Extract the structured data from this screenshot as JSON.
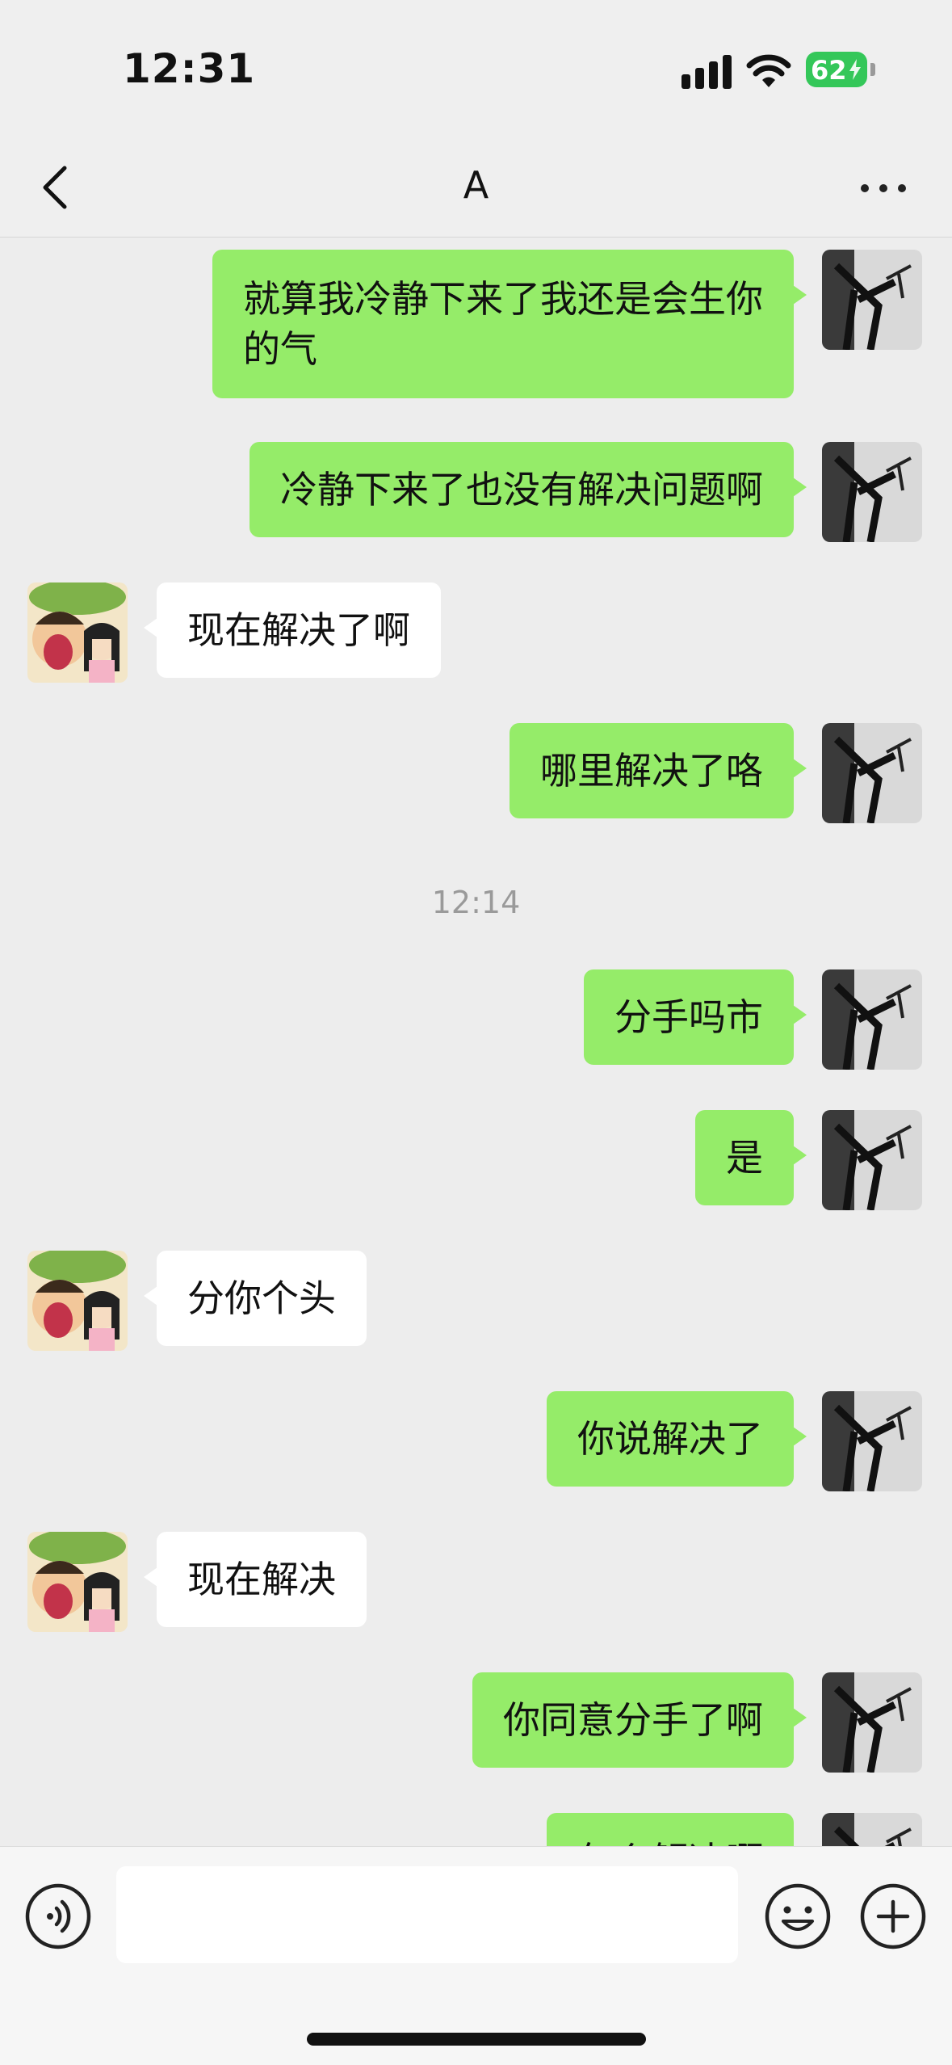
{
  "status_bar": {
    "time": "12:31",
    "battery": "62"
  },
  "header": {
    "title": "A"
  },
  "messages": [
    {
      "from": "me",
      "text": "就算我冷静下来了我还是会生你\n的气"
    },
    {
      "from": "me",
      "text": "冷静下来了也没有解决问题啊"
    },
    {
      "from": "them",
      "text": "现在解决了啊"
    },
    {
      "from": "me",
      "text": "哪里解决了咯"
    },
    {
      "type": "time",
      "text": "12:14"
    },
    {
      "from": "me",
      "text": "分手吗市"
    },
    {
      "from": "me",
      "text": "是"
    },
    {
      "from": "them",
      "text": "分你个头"
    },
    {
      "from": "me",
      "text": "你说解决了"
    },
    {
      "from": "them",
      "text": "现在解决"
    },
    {
      "from": "me",
      "text": "你同意分手了啊"
    },
    {
      "from": "me",
      "text": "怎么解决啊"
    }
  ],
  "input": {
    "value": "",
    "placeholder": ""
  },
  "icons": {
    "back": "chevron-left-icon",
    "more": "more-dots-icon",
    "voice": "voice-icon",
    "emoji": "emoji-icon",
    "plus": "plus-circle-icon"
  },
  "colors": {
    "my_bubble": "#95ec69",
    "their_bubble": "#ffffff",
    "background": "#ededed",
    "battery": "#34c759"
  }
}
